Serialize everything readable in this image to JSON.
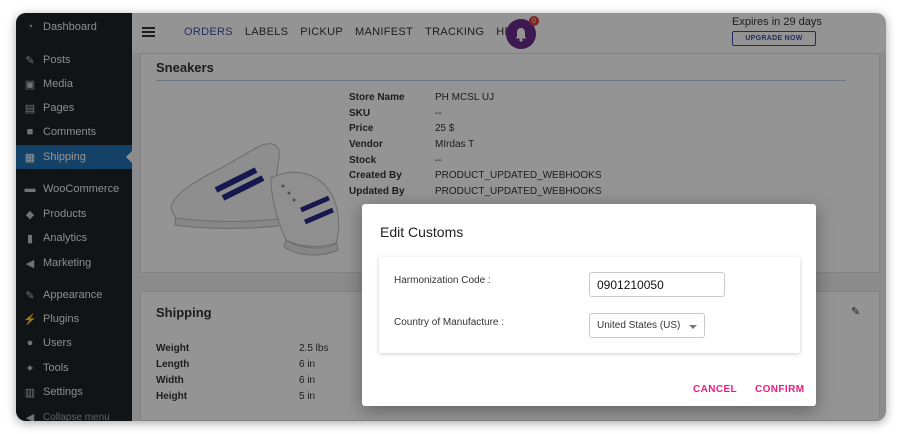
{
  "sidebar": {
    "items": [
      {
        "label": "Dashboard",
        "icon": "dashboard-icon"
      },
      {
        "label": "Posts",
        "icon": "pin-icon"
      },
      {
        "label": "Media",
        "icon": "media-icon"
      },
      {
        "label": "Pages",
        "icon": "pages-icon"
      },
      {
        "label": "Comments",
        "icon": "comment-icon"
      },
      {
        "label": "Shipping",
        "icon": "grid-icon"
      },
      {
        "label": "WooCommerce",
        "icon": "woo-icon"
      },
      {
        "label": "Products",
        "icon": "box-icon"
      },
      {
        "label": "Analytics",
        "icon": "bar-chart-icon"
      },
      {
        "label": "Marketing",
        "icon": "megaphone-icon"
      },
      {
        "label": "Appearance",
        "icon": "brush-icon"
      },
      {
        "label": "Plugins",
        "icon": "plug-icon"
      },
      {
        "label": "Users",
        "icon": "user-icon"
      },
      {
        "label": "Tools",
        "icon": "wrench-icon"
      },
      {
        "label": "Settings",
        "icon": "settings-icon"
      }
    ],
    "active": "Shipping",
    "collapse_label": "Collapse menu"
  },
  "topbar": {
    "nav": [
      "ORDERS",
      "LABELS",
      "PICKUP",
      "MANIFEST",
      "TRACKING",
      "HELP"
    ],
    "active_nav": "ORDERS",
    "notification_count": "0",
    "expires_text": "Expires in 29 days",
    "upgrade_label": "UPGRADE NOW"
  },
  "product": {
    "title": "Sneakers",
    "details": [
      {
        "label": "Store Name",
        "value": "PH MCSL UJ"
      },
      {
        "label": "SKU",
        "value": "--"
      },
      {
        "label": "Price",
        "value": "25 $"
      },
      {
        "label": "Vendor",
        "value": "MIrdas T"
      },
      {
        "label": "Stock",
        "value": "--"
      },
      {
        "label": "Created By",
        "value": "PRODUCT_UPDATED_WEBHOOKS"
      },
      {
        "label": "Updated By",
        "value": "PRODUCT_UPDATED_WEBHOOKS"
      }
    ]
  },
  "shipping": {
    "title": "Shipping",
    "rows": [
      {
        "label": "Weight",
        "value": "2.5 lbs"
      },
      {
        "label": "Length",
        "value": "6 in"
      },
      {
        "label": "Width",
        "value": "6 in"
      },
      {
        "label": "Height",
        "value": "5 in"
      }
    ]
  },
  "dialog": {
    "title": "Edit Customs",
    "hs_label": "Harmonization Code :",
    "hs_value": "0901210050",
    "country_label": "Country of Manufacture :",
    "country_value": "United States (US)",
    "cancel_label": "CANCEL",
    "confirm_label": "CONFIRM"
  },
  "colors": {
    "sidebar_bg": "#1d2327",
    "active_bg": "#2271b1",
    "accent": "#e91e82",
    "nav_active": "#3c50a0"
  }
}
